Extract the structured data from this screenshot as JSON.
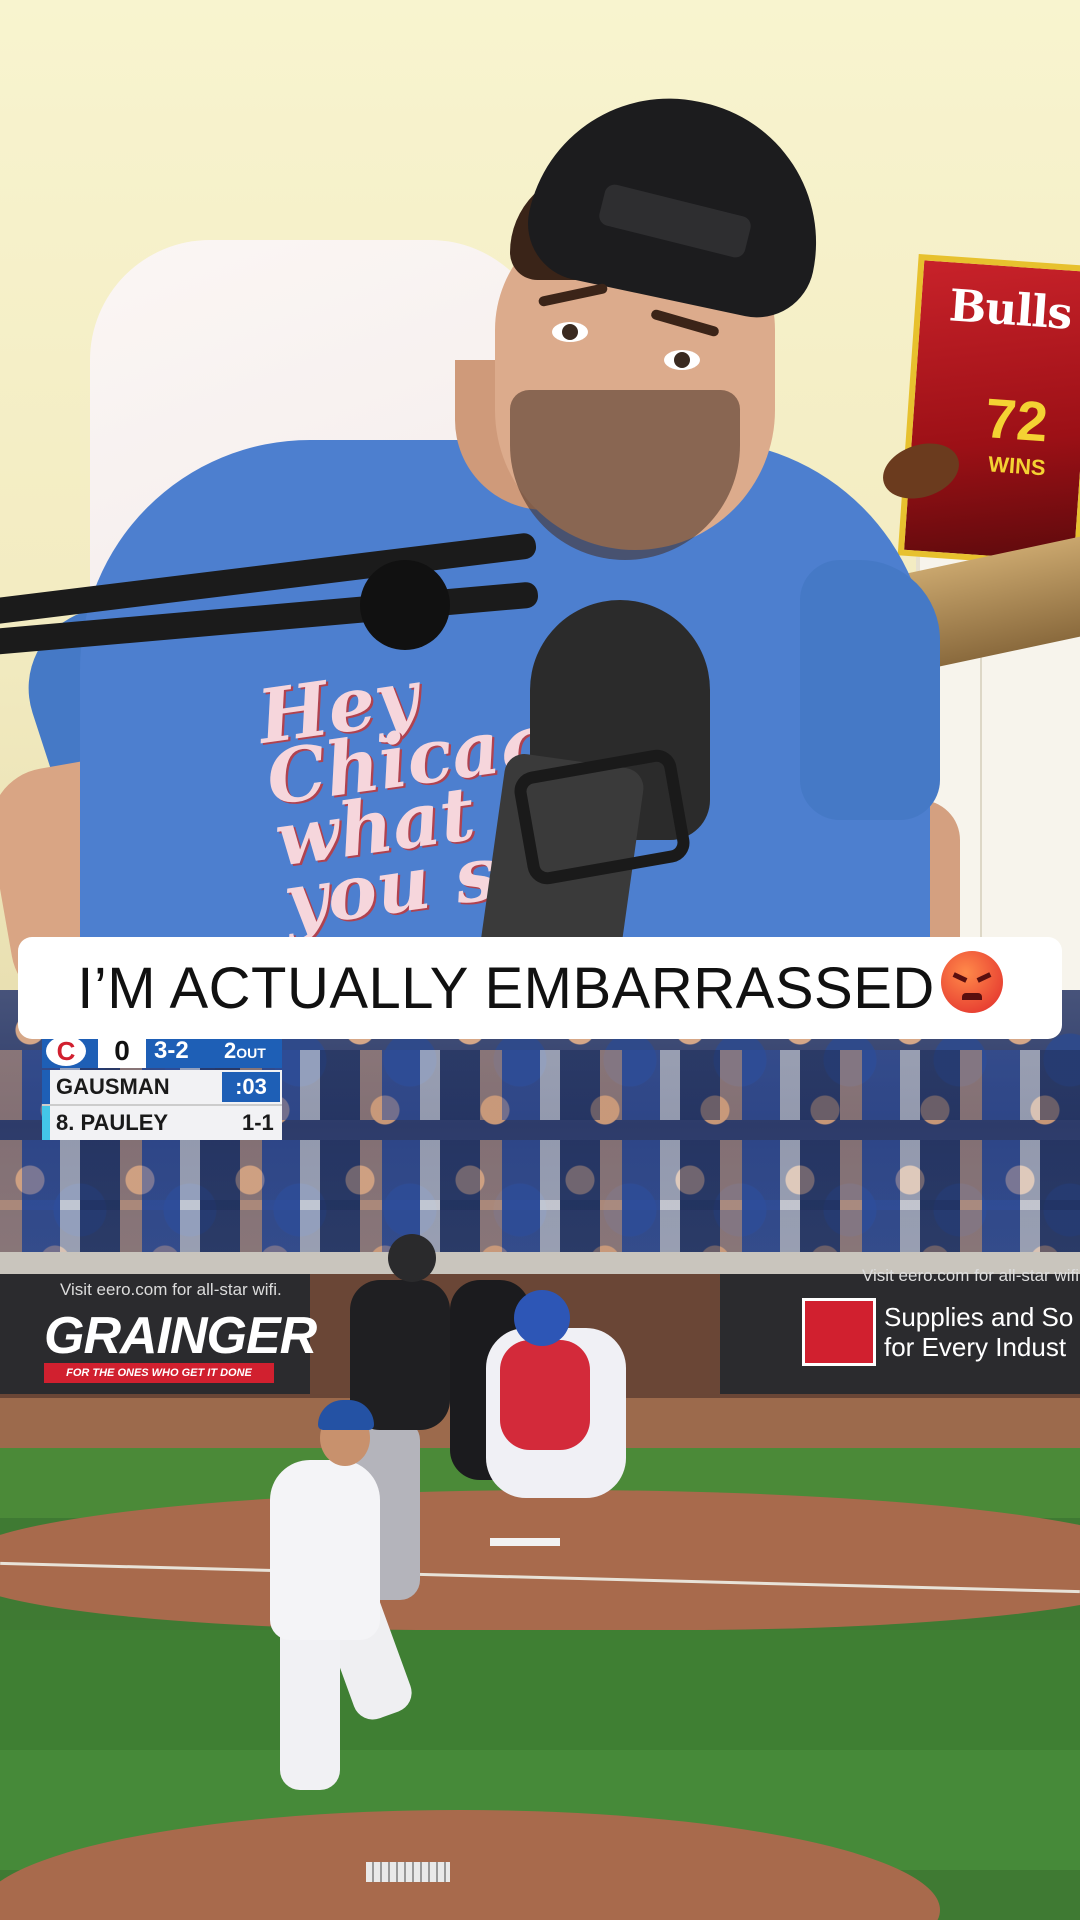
{
  "caption": {
    "text": "I’M ACTUALLY EMBARRASSED",
    "emoji": "angry-face-emoji"
  },
  "scorebug": {
    "team_logo": "C",
    "runs": "0",
    "count": "3-2",
    "outs": "2",
    "outs_label": "OUT",
    "pitcher": "GAUSMAN",
    "pitch_clock": ":03",
    "batter": "8. PAULEY",
    "batter_stat": "1-1"
  },
  "ads": {
    "left_small": "Visit eero.com for all-star wifi.",
    "left_logo": "GRAINGER",
    "left_tagline": "FOR THE ONES WHO GET IT DONE",
    "right_small": "Visit eero.com for all-star wifi",
    "right_line1": "Supplies and So",
    "right_line2": "for Every Indust"
  },
  "background": {
    "magazine_title": "Bulls",
    "magazine_number": "72",
    "magazine_sub": "WINS",
    "shirt_print": "Hey Chicago what do you say"
  },
  "colors": {
    "cubs_blue": "#1e5fb6",
    "cubs_red": "#d1202f",
    "caption_bg": "#ffffff",
    "wall_bg": "#f8f4cf"
  }
}
